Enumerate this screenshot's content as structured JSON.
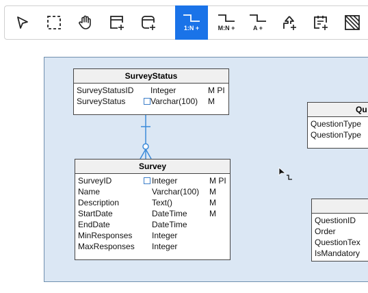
{
  "toolbar": {
    "tools": [
      {
        "name": "select",
        "label": ""
      },
      {
        "name": "marquee",
        "label": ""
      },
      {
        "name": "pan",
        "label": ""
      },
      {
        "name": "entity",
        "label": ""
      },
      {
        "name": "view",
        "label": ""
      },
      {
        "name": "rel-1n",
        "label": "1:N +",
        "active": true
      },
      {
        "name": "rel-mn",
        "label": "M:N +"
      },
      {
        "name": "rel-a",
        "label": "A +"
      },
      {
        "name": "inherit",
        "label": ""
      },
      {
        "name": "note",
        "label": ""
      },
      {
        "name": "hatch",
        "label": ""
      }
    ]
  },
  "entities": {
    "survey_status": {
      "title": "SurveyStatus",
      "rows": [
        {
          "name": "SurveyStatusID",
          "type": "Integer",
          "flags": "M PI"
        },
        {
          "name": "SurveyStatus",
          "type": "Varchar(100)",
          "flags": "M"
        }
      ]
    },
    "survey": {
      "title": "Survey",
      "rows": [
        {
          "name": "SurveyID",
          "type": "Integer",
          "flags": "M PI"
        },
        {
          "name": "Name",
          "type": "Varchar(100)",
          "flags": "M"
        },
        {
          "name": "Description",
          "type": "Text()",
          "flags": "M"
        },
        {
          "name": "StartDate",
          "type": "DateTime",
          "flags": "M"
        },
        {
          "name": "EndDate",
          "type": "DateTime",
          "flags": ""
        },
        {
          "name": "MinResponses",
          "type": "Integer",
          "flags": ""
        },
        {
          "name": "MaxResponses",
          "type": "Integer",
          "flags": ""
        }
      ]
    },
    "question_type": {
      "title": "Qu",
      "rows": [
        {
          "name": "QuestionType"
        },
        {
          "name": "QuestionType"
        }
      ]
    },
    "question": {
      "title": "",
      "rows": [
        {
          "name": "QuestionID"
        },
        {
          "name": "Order"
        },
        {
          "name": "QuestionTex"
        },
        {
          "name": "IsMandatory"
        }
      ]
    }
  }
}
